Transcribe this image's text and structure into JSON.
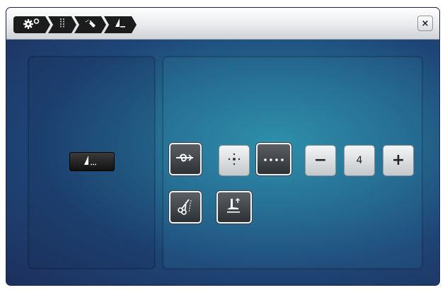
{
  "breadcrumb": {
    "items": [
      {
        "icon": "settings-gears-icon"
      },
      {
        "icon": "stitch-line-icon"
      },
      {
        "icon": "needle-thread-icon"
      },
      {
        "icon": "foot-stitch-icon"
      }
    ]
  },
  "close_label": "×",
  "left_panel": {
    "stitch_icon": "stitch-length-icon"
  },
  "controls": {
    "tie_off_icon": "knot-icon",
    "single_point_icon": "single-dot-icon",
    "dotted_line_icon": "dotted-line-icon",
    "minus_label": "−",
    "value": "4",
    "plus_label": "+",
    "cut_thread_icon": "scissors-icon",
    "presser_foot_icon": "presser-foot-up-icon"
  },
  "colors": {
    "titlebar": "#e9eaec",
    "background_center": "#2d8fa8",
    "background_edge": "#1d2f5c",
    "crumb": "#1c1c1c"
  }
}
